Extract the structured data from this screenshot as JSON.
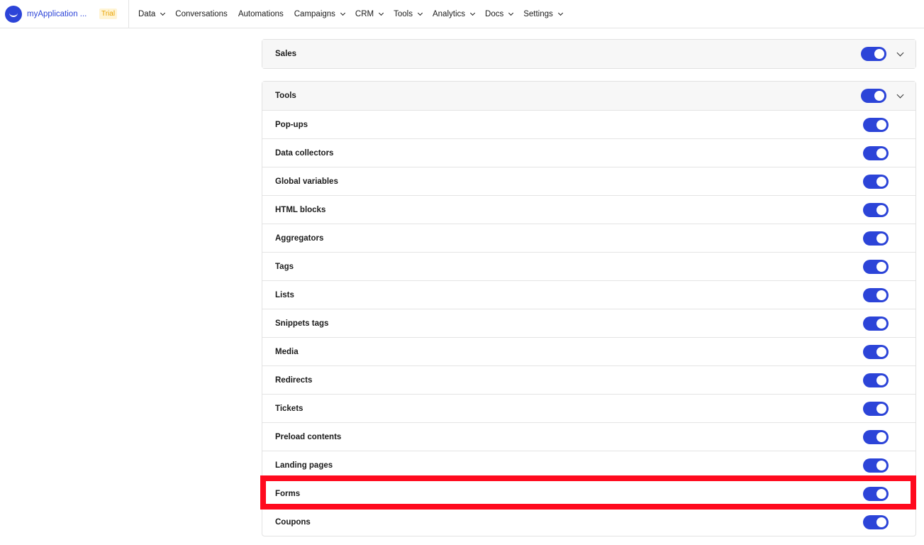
{
  "brand": {
    "name": "myApplication ...",
    "badge": "Trial"
  },
  "nav": [
    {
      "label": "Data",
      "has_dropdown": true
    },
    {
      "label": "Conversations",
      "has_dropdown": false
    },
    {
      "label": "Automations",
      "has_dropdown": false
    },
    {
      "label": "Campaigns",
      "has_dropdown": true
    },
    {
      "label": "CRM",
      "has_dropdown": true
    },
    {
      "label": "Tools",
      "has_dropdown": true
    },
    {
      "label": "Analytics",
      "has_dropdown": true
    },
    {
      "label": "Docs",
      "has_dropdown": true
    },
    {
      "label": "Settings",
      "has_dropdown": true
    }
  ],
  "sales_section": {
    "title": "Sales",
    "enabled": true
  },
  "tools_section": {
    "title": "Tools",
    "enabled": true,
    "items": [
      {
        "label": "Pop-ups",
        "enabled": true
      },
      {
        "label": "Data collectors",
        "enabled": true
      },
      {
        "label": "Global variables",
        "enabled": true
      },
      {
        "label": "HTML blocks",
        "enabled": true
      },
      {
        "label": "Aggregators",
        "enabled": true
      },
      {
        "label": "Tags",
        "enabled": true
      },
      {
        "label": "Lists",
        "enabled": true
      },
      {
        "label": "Snippets tags",
        "enabled": true
      },
      {
        "label": "Media",
        "enabled": true
      },
      {
        "label": "Redirects",
        "enabled": true
      },
      {
        "label": "Tickets",
        "enabled": true
      },
      {
        "label": "Preload contents",
        "enabled": true
      },
      {
        "label": "Landing pages",
        "enabled": true
      },
      {
        "label": "Forms",
        "enabled": true,
        "highlighted": true
      },
      {
        "label": "Coupons",
        "enabled": true
      }
    ]
  },
  "colors": {
    "accent": "#2c44d8",
    "highlight": "#ff0a1e",
    "badge_text": "#e8a200",
    "badge_bg": "#fff4d4"
  }
}
